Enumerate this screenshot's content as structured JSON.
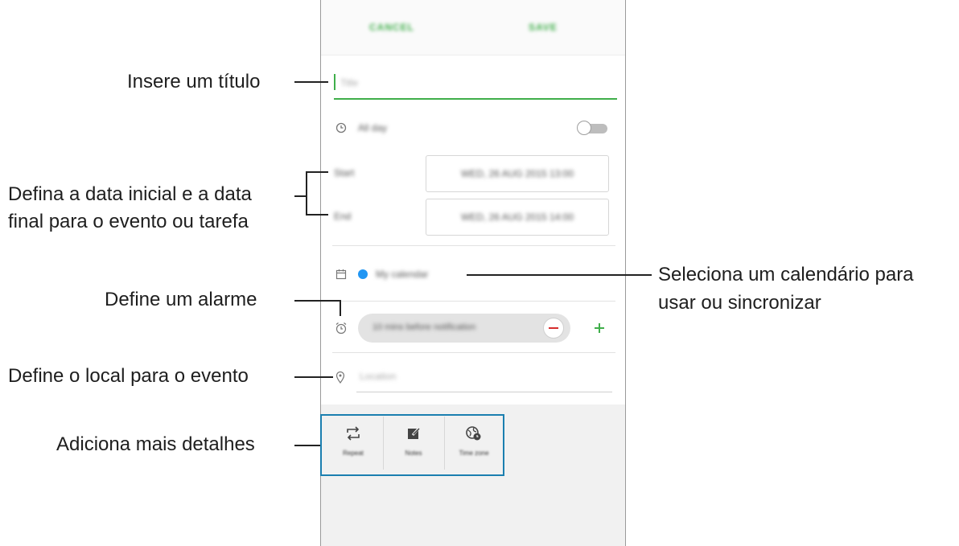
{
  "header": {
    "cancel_label": "CANCEL",
    "save_label": "SAVE"
  },
  "form": {
    "title_placeholder": "Title",
    "all_day_label": "All day",
    "all_day_on": false,
    "start_label": "Start",
    "start_value": "WED, 26 AUG 2015 13:00",
    "end_label": "End",
    "end_value": "WED, 26 AUG 2015 14:00",
    "calendar_name": "My calendar",
    "calendar_color": "#2196f3",
    "alarm_value": "10 mins before notification",
    "location_placeholder": "Location",
    "accent_color": "#3fae4a",
    "remove_color": "#d62d2d"
  },
  "details": [
    {
      "label": "Repeat",
      "icon": "repeat-icon"
    },
    {
      "label": "Notes",
      "icon": "edit-note-icon"
    },
    {
      "label": "Time zone",
      "icon": "time-zone-icon"
    }
  ],
  "annotations": {
    "title": "Insere um título",
    "dates_line1": "Defina a data inicial e a data",
    "dates_line2": "final para o evento ou tarefa",
    "calendar_line1": "Seleciona um calendário para",
    "calendar_line2": "usar ou sincronizar",
    "alarm": "Define um alarme",
    "location": "Define o local para o evento",
    "details": "Adiciona mais detalhes"
  }
}
